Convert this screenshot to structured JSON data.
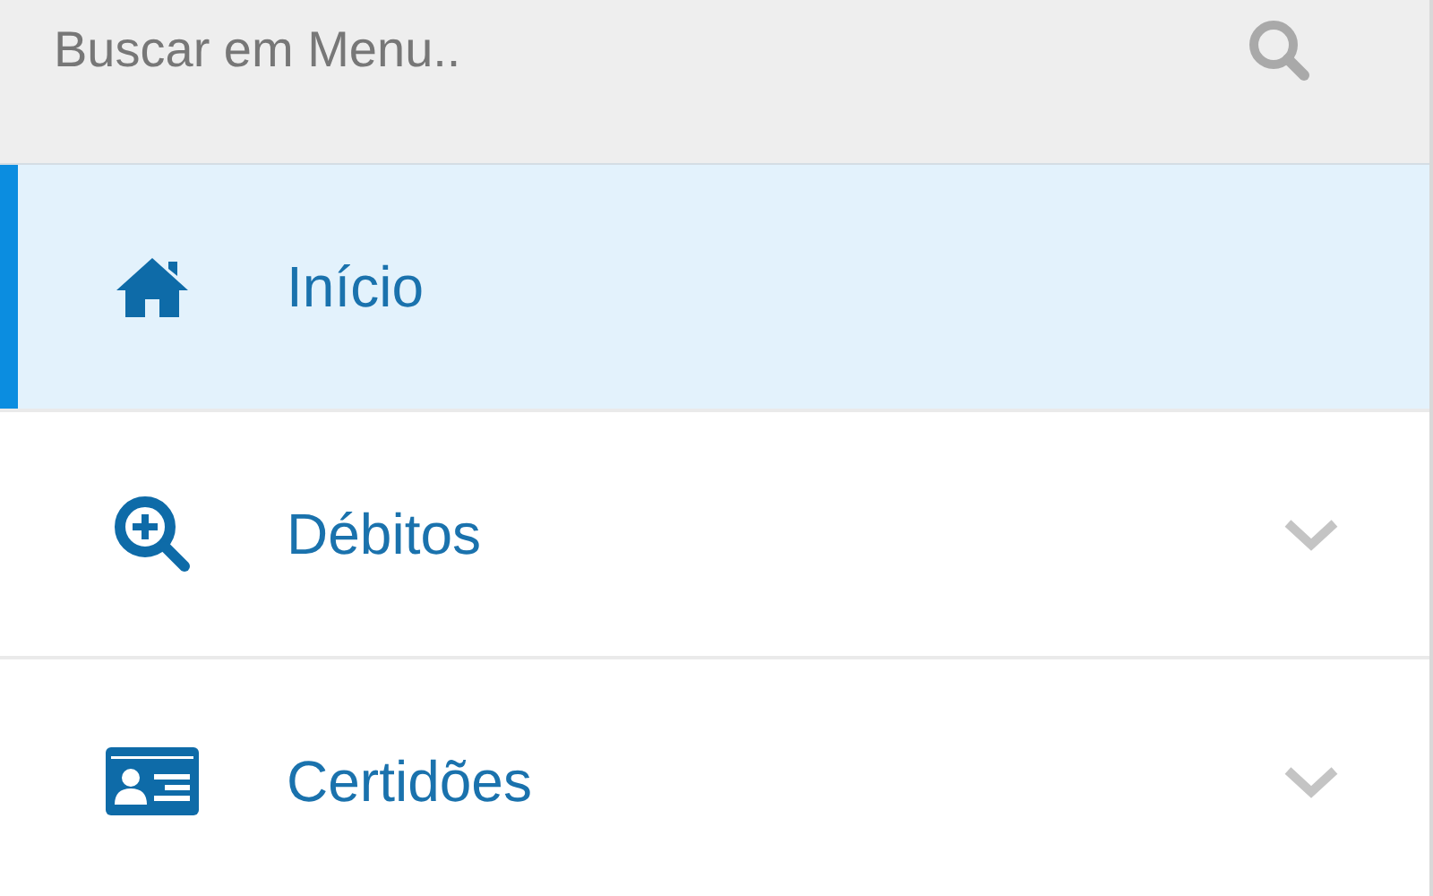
{
  "search": {
    "placeholder": "Buscar em Menu.."
  },
  "items": [
    {
      "label": "Início",
      "kind": "home",
      "selected": true,
      "expandable": false
    },
    {
      "label": "Débitos",
      "kind": "search-plus",
      "selected": false,
      "expandable": true
    },
    {
      "label": "Certidões",
      "kind": "id-card",
      "selected": false,
      "expandable": true
    }
  ]
}
